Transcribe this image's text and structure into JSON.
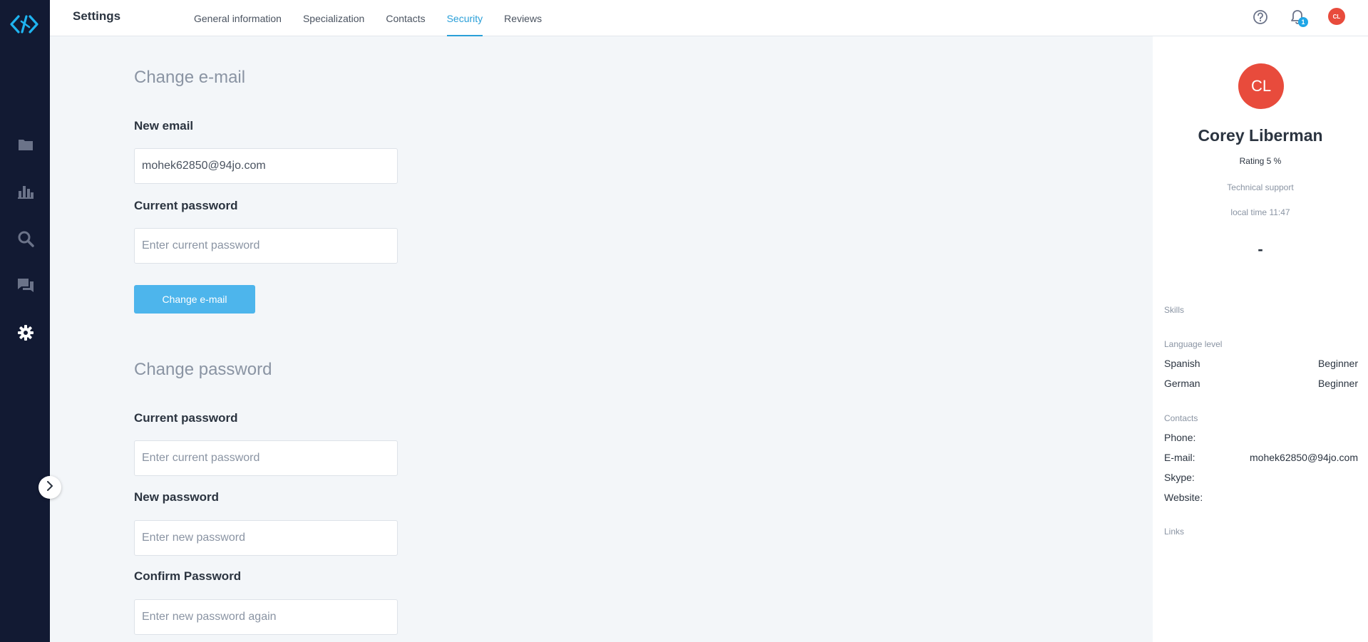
{
  "header": {
    "title": "Settings",
    "tabs": [
      {
        "label": "General information",
        "active": false
      },
      {
        "label": "Specialization",
        "active": false
      },
      {
        "label": "Contacts",
        "active": false
      },
      {
        "label": "Security",
        "active": true
      },
      {
        "label": "Reviews",
        "active": false
      }
    ],
    "notification_count": "1",
    "avatar_initials": "CL"
  },
  "sidebar": {
    "items": [
      "folder-icon",
      "bar-chart-icon",
      "search-icon",
      "chat-icon",
      "gear-icon"
    ]
  },
  "change_email": {
    "title": "Change e-mail",
    "new_email_label": "New email",
    "new_email_value": "mohek62850@94jo.com",
    "current_password_label": "Current password",
    "current_password_placeholder": "Enter current password",
    "button_label": "Change e-mail"
  },
  "change_password": {
    "title": "Change password",
    "current_password_label": "Current password",
    "current_password_placeholder": "Enter current password",
    "new_password_label": "New password",
    "new_password_placeholder": "Enter new password",
    "confirm_password_label": "Confirm Password",
    "confirm_password_placeholder": "Enter new password again"
  },
  "profile": {
    "initials": "CL",
    "name": "Corey Liberman",
    "rating": "Rating 5 %",
    "role": "Technical support",
    "local_time": "local time 11:47",
    "dash": "-",
    "skills_heading": "Skills",
    "language_heading": "Language level",
    "languages": [
      {
        "name": "Spanish",
        "level": "Beginner"
      },
      {
        "name": "German",
        "level": "Beginner"
      }
    ],
    "contacts_heading": "Contacts",
    "contacts": [
      {
        "label": "Phone:",
        "value": ""
      },
      {
        "label": "E-mail:",
        "value": "mohek62850@94jo.com"
      },
      {
        "label": "Skype:",
        "value": ""
      },
      {
        "label": "Website:",
        "value": ""
      }
    ],
    "links_heading": "Links"
  },
  "colors": {
    "sidebar": "#121a33",
    "accent": "#2a9fd8",
    "button": "#4db5ec",
    "avatar": "#e84b3c"
  }
}
